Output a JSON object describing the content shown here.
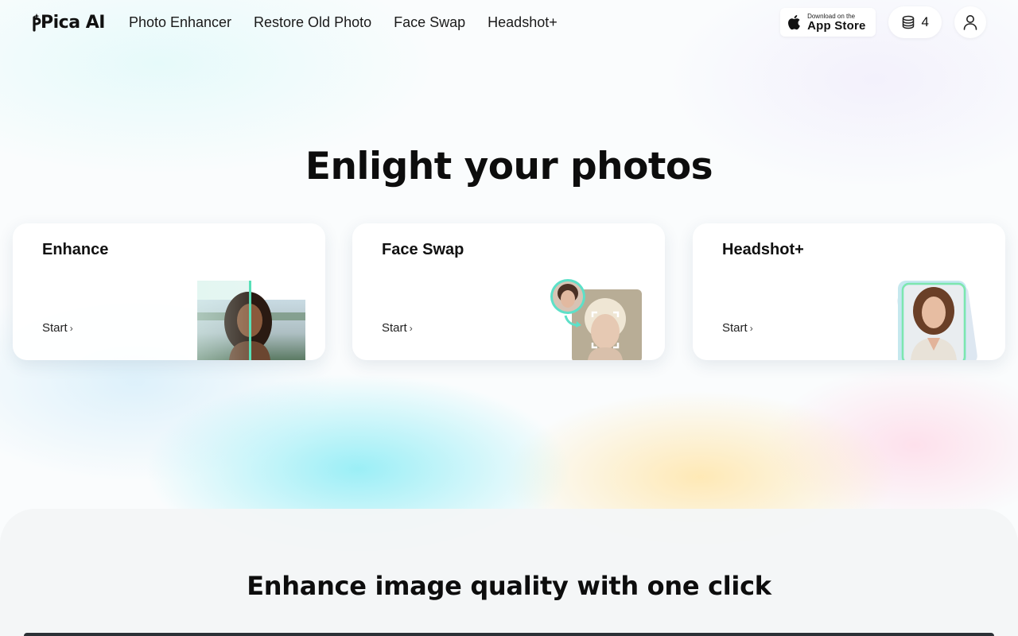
{
  "brand": {
    "name": "Pica AI"
  },
  "nav": {
    "items": [
      {
        "label": "Photo Enhancer"
      },
      {
        "label": "Restore Old Photo"
      },
      {
        "label": "Face Swap"
      },
      {
        "label": "Headshot+"
      }
    ]
  },
  "header": {
    "appstore": {
      "small": "Download on the",
      "big": "App Store"
    },
    "credits": "4"
  },
  "hero": {
    "title": "Enlight your photos"
  },
  "cards": [
    {
      "title": "Enhance",
      "start": "Start"
    },
    {
      "title": "Face Swap",
      "start": "Start"
    },
    {
      "title": "Headshot+",
      "start": "Start"
    }
  ],
  "section2": {
    "title": "Enhance image quality with one click"
  },
  "colors": {
    "accent_teal": "#5de0c8",
    "accent_lime": "#b9f27a"
  }
}
